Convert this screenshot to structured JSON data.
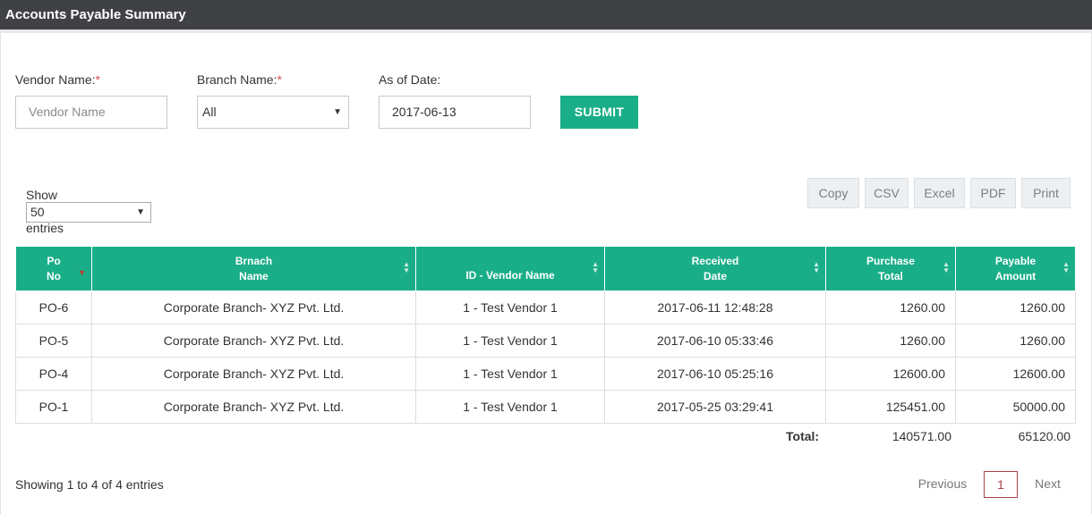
{
  "header": {
    "title": "Accounts Payable Summary"
  },
  "form": {
    "vendor_label": "Vendor Name:",
    "branch_label": "Branch Name:",
    "date_label": "As of Date:",
    "required_mark": "*",
    "vendor_placeholder": "Vendor Name",
    "branch_value": "All",
    "date_value": "2017-06-13",
    "submit_label": "SUBMIT"
  },
  "length_menu": {
    "show_label": "Show",
    "value": "50",
    "entries_label": "entries"
  },
  "export_buttons": [
    "Copy",
    "CSV",
    "Excel",
    "PDF",
    "Print"
  ],
  "table": {
    "columns": [
      {
        "line1": "Po",
        "line2": "No"
      },
      {
        "line1": "Brnach",
        "line2": "Name"
      },
      {
        "line1": "",
        "line2": "ID - Vendor Name"
      },
      {
        "line1": "Received",
        "line2": "Date"
      },
      {
        "line1": "Purchase",
        "line2": "Total"
      },
      {
        "line1": "Payable",
        "line2": "Amount"
      }
    ],
    "rows": [
      [
        "PO-6",
        "Corporate Branch- XYZ Pvt. Ltd.",
        "1 - Test Vendor 1",
        "2017-06-11 12:48:28",
        "1260.00",
        "1260.00"
      ],
      [
        "PO-5",
        "Corporate Branch- XYZ Pvt. Ltd.",
        "1 - Test Vendor 1",
        "2017-06-10 05:33:46",
        "1260.00",
        "1260.00"
      ],
      [
        "PO-4",
        "Corporate Branch- XYZ Pvt. Ltd.",
        "1 - Test Vendor 1",
        "2017-06-10 05:25:16",
        "12600.00",
        "12600.00"
      ],
      [
        "PO-1",
        "Corporate Branch- XYZ Pvt. Ltd.",
        "1 - Test Vendor 1",
        "2017-05-25 03:29:41",
        "125451.00",
        "50000.00"
      ]
    ],
    "total_label": "Total:",
    "total_purchase": "140571.00",
    "total_payable": "65120.00"
  },
  "footer": {
    "info": "Showing 1 to 4 of 4 entries",
    "previous": "Previous",
    "current_page": "1",
    "next": "Next"
  },
  "colors": {
    "accent": "#1aae88",
    "titlebar": "#3f4144",
    "required": "#d9534f"
  }
}
